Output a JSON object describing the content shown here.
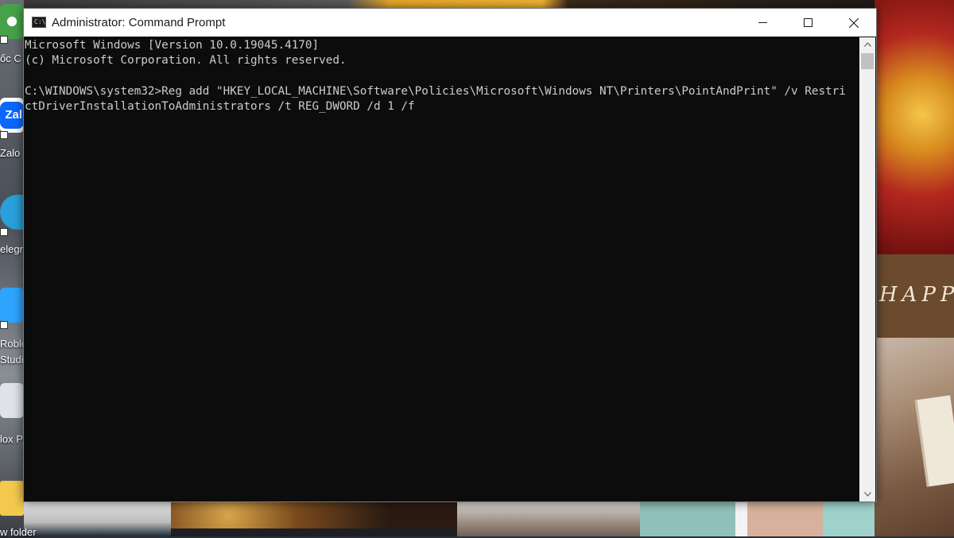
{
  "window": {
    "title": "Administrator: Command Prompt",
    "title_icon": "console-icon"
  },
  "console": {
    "lines": [
      "Microsoft Windows [Version 10.0.19045.4170]",
      "(c) Microsoft Corporation. All rights reserved.",
      "",
      "C:\\WINDOWS\\system32>Reg add \"HKEY_LOCAL_MACHINE\\Software\\Policies\\Microsoft\\Windows NT\\Printers\\PointAndPrint\" /v Restri",
      "ctDriverInstallationToAdministrators /t REG_DWORD /d 1 /f"
    ]
  },
  "desktop": {
    "icons": [
      {
        "label": "ốc C",
        "icon": "coccoc-browser-icon"
      },
      {
        "label": "Zalo",
        "icon": "zalo-icon",
        "badge": "Zal"
      },
      {
        "label": "elegr",
        "icon": "telegram-icon"
      },
      {
        "label": "Roblo",
        "label2": "Studi",
        "icon": "roblox-studio-icon"
      },
      {
        "label": "lox P",
        "icon": "roblox-player-icon"
      },
      {
        "label": "w folder",
        "icon": "folder-icon"
      }
    ],
    "wallpaper_text": "HAPP"
  },
  "colors": {
    "console_bg": "#0c0c0c",
    "console_text": "#cccccc",
    "titlebar_bg": "#ffffff"
  }
}
